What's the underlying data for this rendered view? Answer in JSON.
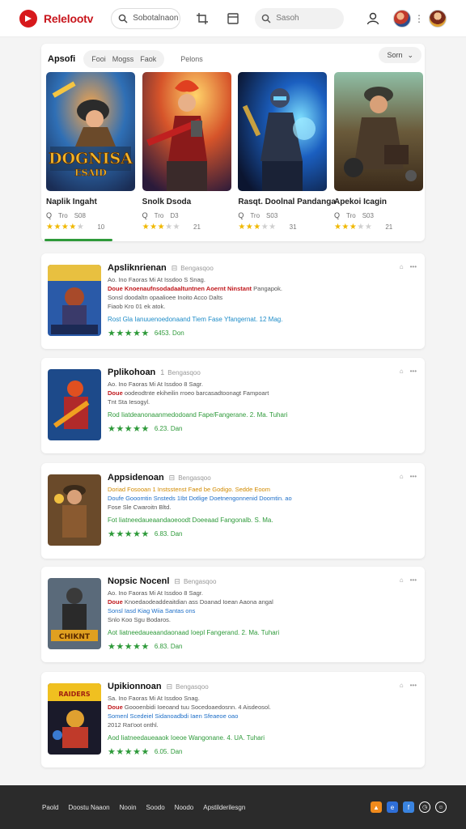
{
  "header": {
    "brand": "Relelootv",
    "search_primary_placeholder": "Sobotalnaon",
    "search_secondary_placeholder": "Sasoh",
    "icons": [
      "logo-icon",
      "search-icon",
      "crop-icon",
      "window-icon",
      "search-icon",
      "user-icon",
      "avatar",
      "more-icon",
      "avatar"
    ],
    "brand_color": "#c8161d"
  },
  "featured": {
    "title": "Apsofi",
    "chips": [
      "Fooi",
      "Mogss",
      "Faok"
    ],
    "link": "Pelons",
    "sort_label": "Sorn",
    "sort_icon": "chevron-down-icon",
    "games": [
      {
        "name": "Naplik Ingaht",
        "meta_a": "Tro",
        "meta_b": "S08",
        "rating": 4,
        "count": "10",
        "art_text": "DOGNISA",
        "art_sub": "ESAID"
      },
      {
        "name": "Snolk Dsoda",
        "meta_a": "Tro",
        "meta_b": "D3",
        "rating": 3,
        "count": "21"
      },
      {
        "name": "Rasqt. Doolnal Pandanga",
        "meta_a": "Tro",
        "meta_b": "S03",
        "rating": 3,
        "count": "31"
      },
      {
        "name": "Apekoi Icagin",
        "meta_a": "Tro",
        "meta_b": "S03",
        "rating": 3,
        "count": "21"
      }
    ],
    "accent_color": "#2e9a3a"
  },
  "list": [
    {
      "title": "Apsliknrienan",
      "subtitle": "Bengasqoo",
      "line1": "Ao. Ino Faoras Mi At Issdoo S Snag.",
      "line2_red": "Doue Knoenaufnsodadaaltuntnen Aoernt Ninstant",
      "line2_rest": "Pangapok.",
      "line3": "Sonsl doodaltn opaalioee Inoito Acco Dalts",
      "line4": "Fiaob Kro 01 ek atok.",
      "highlight": "Rost Gla Ianuuenoedonaand Tiem Fase Yfangernat. 12 Mag.",
      "highlight_color": "blue",
      "price": "6453. Don",
      "art_text": "KNIGHT"
    },
    {
      "title": "Pplikohoan",
      "subtitle": "Bengasqoo",
      "line1": "Ao. Ino Faoras Mi At Issdoo 8 Sagr.",
      "line2_red": "Doue",
      "line2_rest": "oodeodtnte ekiheilin rroeo barcasadtoonagt Fampoart",
      "line3": "Tnt Sta Iesogyl.",
      "line4": "",
      "highlight": "Rod Iiatdeanonaanmedodoand Fape/Fangerane. 2. Ma. Tuhari",
      "highlight_color": "green",
      "price": "6.23. Dan",
      "art_text": ""
    },
    {
      "title": "Appsidenoan",
      "subtitle": "Bengasqoo",
      "line1": "Doriad Fosooan 1 Instsstenst Faed be Godigo. Sedde Eoom",
      "line2_red": "",
      "line2_rest": "Doufe Gooomtin Snsteds 1Ibt Dotlige Doetnengonnenid Doomtin. ao",
      "line3": "Fose Sle Cwaroitn Bltd.",
      "line4": "",
      "highlight": "Fot Iiatneedaueaandaoeoodt Doeeaad Fangonalb. S. Ma.",
      "highlight_color": "green",
      "price": "6.83. Dan",
      "art_text": ""
    },
    {
      "title": "Nopsic Nocenl",
      "subtitle": "Bengasqoo",
      "line1": "Ao. Ino Faoras Mi At Issdoo 8 Sagr.",
      "line2_red": "Doue",
      "line2_rest": "Knoedaodeaddeaitdian ass Doanad Ioean Aaona angal",
      "line3": "Sonsl Iasd Kiag Wiia Santas ons",
      "line4": "Snlo Koo Sgu Bodaros.",
      "highlight": "Aot Iiatneedaueaandaonaad Ioepl Fangerand. 2. Ma. Tuhari",
      "highlight_color": "green",
      "price": "6.83. Dan",
      "art_text": "CHIKNT"
    },
    {
      "title": "Upikionnoan",
      "subtitle": "Bengasqoo",
      "line1": "Sa. Ino Faoras Mi At Issdoo Snag.",
      "line2_red": "Doue",
      "line2_rest": "Goooenbidi Ioeoand tuu Socedoaedosnn. 4 Aisdeosol.",
      "line3": "Somenl Scedeiel Sidanoadbdi Iaen Sfeaeoe oao",
      "line4": "2012 Rat'oot onthl.",
      "highlight": "Aod Iiatneedaueaaok Ioeoe Wangonane. 4. UA. Tuhari",
      "highlight_color": "green",
      "price": "6.05. Dan",
      "art_text": "RAIDERS"
    }
  ],
  "footer": {
    "links": [
      "Paold",
      "Doostu Naaon",
      "Nooin",
      "Soodo",
      "Noodo",
      "Apstilderilesgn"
    ],
    "icons": [
      "orange-app-icon",
      "blue-app-icon",
      "blue2-app-icon",
      "clock-icon",
      "smile-icon"
    ]
  }
}
